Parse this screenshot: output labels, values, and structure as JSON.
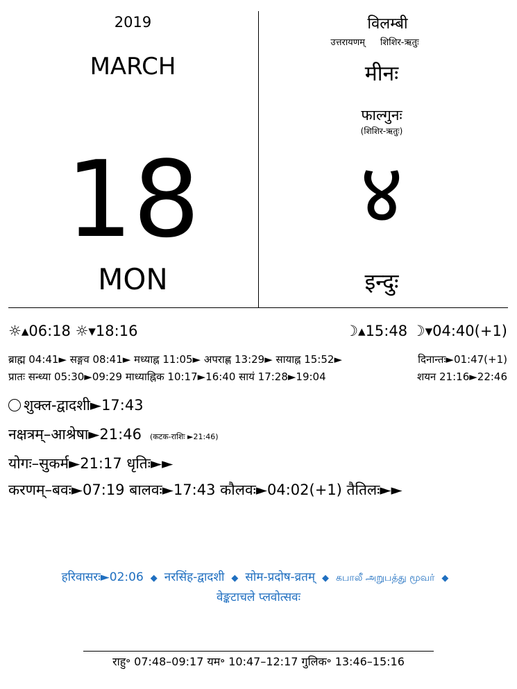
{
  "gregorian": {
    "year": "2019",
    "month": "MARCH",
    "day": "18",
    "weekday": "MON"
  },
  "panchanga": {
    "samvatsara": "विलम्बी",
    "ayana": "उत्तरायणम्",
    "ritu": "शिशिर-ऋतुः",
    "rashi": "मीनः",
    "masa": "फाल्गुनः",
    "masa_ritu": "(शिशिर-ऋतुः)",
    "tithi_date": "४",
    "vara": "इन्दुः"
  },
  "timings": {
    "sun": "☼▴06:18 ☼▾18:16",
    "moon": "☽▴15:48 ☽▾04:40(+1)",
    "kala1": "ब्राह्म 04:41► सङ्गव 08:41► मध्याह्न 11:05► अपराह्ण 13:29► सायाह्न 15:52►",
    "dinanta": "दिनान्तः►01:47(+1)",
    "kala2": "प्रातः सन्ध्या 05:30►09:29 माध्याह्निक 10:17►16:40 सायं 17:28►19:04",
    "shayana": "शयन 21:16►22:46"
  },
  "angas": {
    "tithi": "शुक्ल-द्वादशी►17:43",
    "nakshatra": "नक्षत्रम्–आश्रेषा►21:46",
    "nakshatra_note": "(कटक-राशिः ►21:46)",
    "yoga": "योगः–सुकर्म►21:17 धृतिः►►",
    "karana": "करणम्–बवः►07:19 बालवः►17:43 कौलवः►04:02(+1) तैतिलः►►"
  },
  "festivals": {
    "f1": "हरिवासरः►02:06",
    "f2": "नरसिंह-द्वादशी",
    "f3": "सोम-प्रदोष-व्रतम्",
    "f4": "கபாலீ அறுபத்து மூவர்",
    "f5": "वेङ्कटाचले प्लवोत्सवः",
    "separator": "◆"
  },
  "inauspicious": "राहु॰ 07:48–09:17 यम॰ 10:47–12:17 गुलिक॰ 13:46–15:16",
  "colors": {
    "festival_blue": "#1f6fc0"
  }
}
